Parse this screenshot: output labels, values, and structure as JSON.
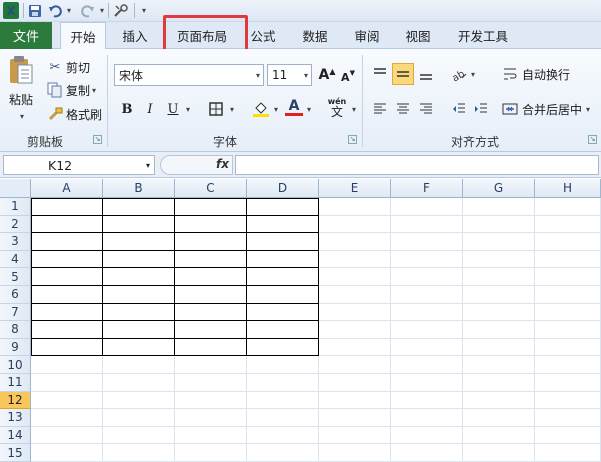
{
  "quick_access": {
    "app_icon_letter": "X",
    "icons": [
      "save-icon",
      "undo-icon",
      "redo-icon",
      "customize-icon"
    ]
  },
  "tabs": {
    "file": "文件",
    "items": [
      "开始",
      "插入",
      "页面布局",
      "公式",
      "数据",
      "审阅",
      "视图",
      "开发工具"
    ],
    "active": "开始",
    "highlighted": "页面布局"
  },
  "clipboard": {
    "paste": "粘贴",
    "cut": "剪切",
    "copy": "复制",
    "format_painter": "格式刷",
    "label": "剪贴板"
  },
  "font": {
    "name": "宋体",
    "size": "11",
    "bold": "B",
    "italic": "I",
    "underline": "U",
    "grow": "A",
    "shrink": "A",
    "font_color_letter": "A",
    "phonetic": "wén",
    "phonetic_char": "文",
    "label": "字体"
  },
  "alignment": {
    "wrap_text": "自动换行",
    "merge_center": "合并后居中",
    "label": "对齐方式"
  },
  "formula_bar": {
    "name_box": "K12",
    "fx": "fx",
    "value": ""
  },
  "grid": {
    "columns": [
      "A",
      "B",
      "C",
      "D",
      "E",
      "F",
      "G",
      "H"
    ],
    "rows": [
      "1",
      "2",
      "3",
      "4",
      "5",
      "6",
      "7",
      "8",
      "9",
      "10",
      "11",
      "12",
      "13",
      "14",
      "15"
    ],
    "selected_row": "12"
  },
  "colors": {
    "file_tab": "#2d7b3c",
    "highlight": "#e0393e",
    "selected_row": "#f9c65b"
  }
}
